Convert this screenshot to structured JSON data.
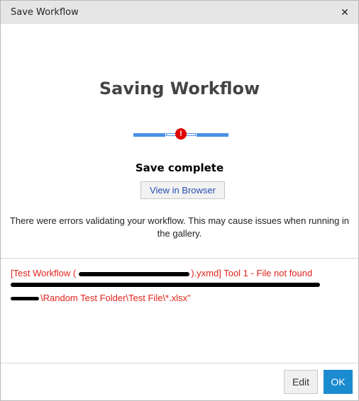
{
  "window": {
    "title": "Save Workflow",
    "close_icon": "close-icon"
  },
  "main": {
    "heading": "Saving Workflow",
    "progress_state": "error",
    "error_icon_glyph": "!",
    "status": "Save complete",
    "view_button_label": "View in Browser",
    "message": "There were errors validating your workflow. This may cause issues when running in the gallery."
  },
  "errors": {
    "line1_prefix": "[Test Workflow (",
    "line1_suffix": ").yxmd] Tool 1 - File not found",
    "line2_suffix": "\\Random Test Folder\\Test File\\*.xlsx\""
  },
  "footer": {
    "edit_label": "Edit",
    "ok_label": "OK"
  },
  "colors": {
    "accent": "#1b8bd0",
    "progress": "#4a90e2",
    "error": "#e0231c"
  }
}
